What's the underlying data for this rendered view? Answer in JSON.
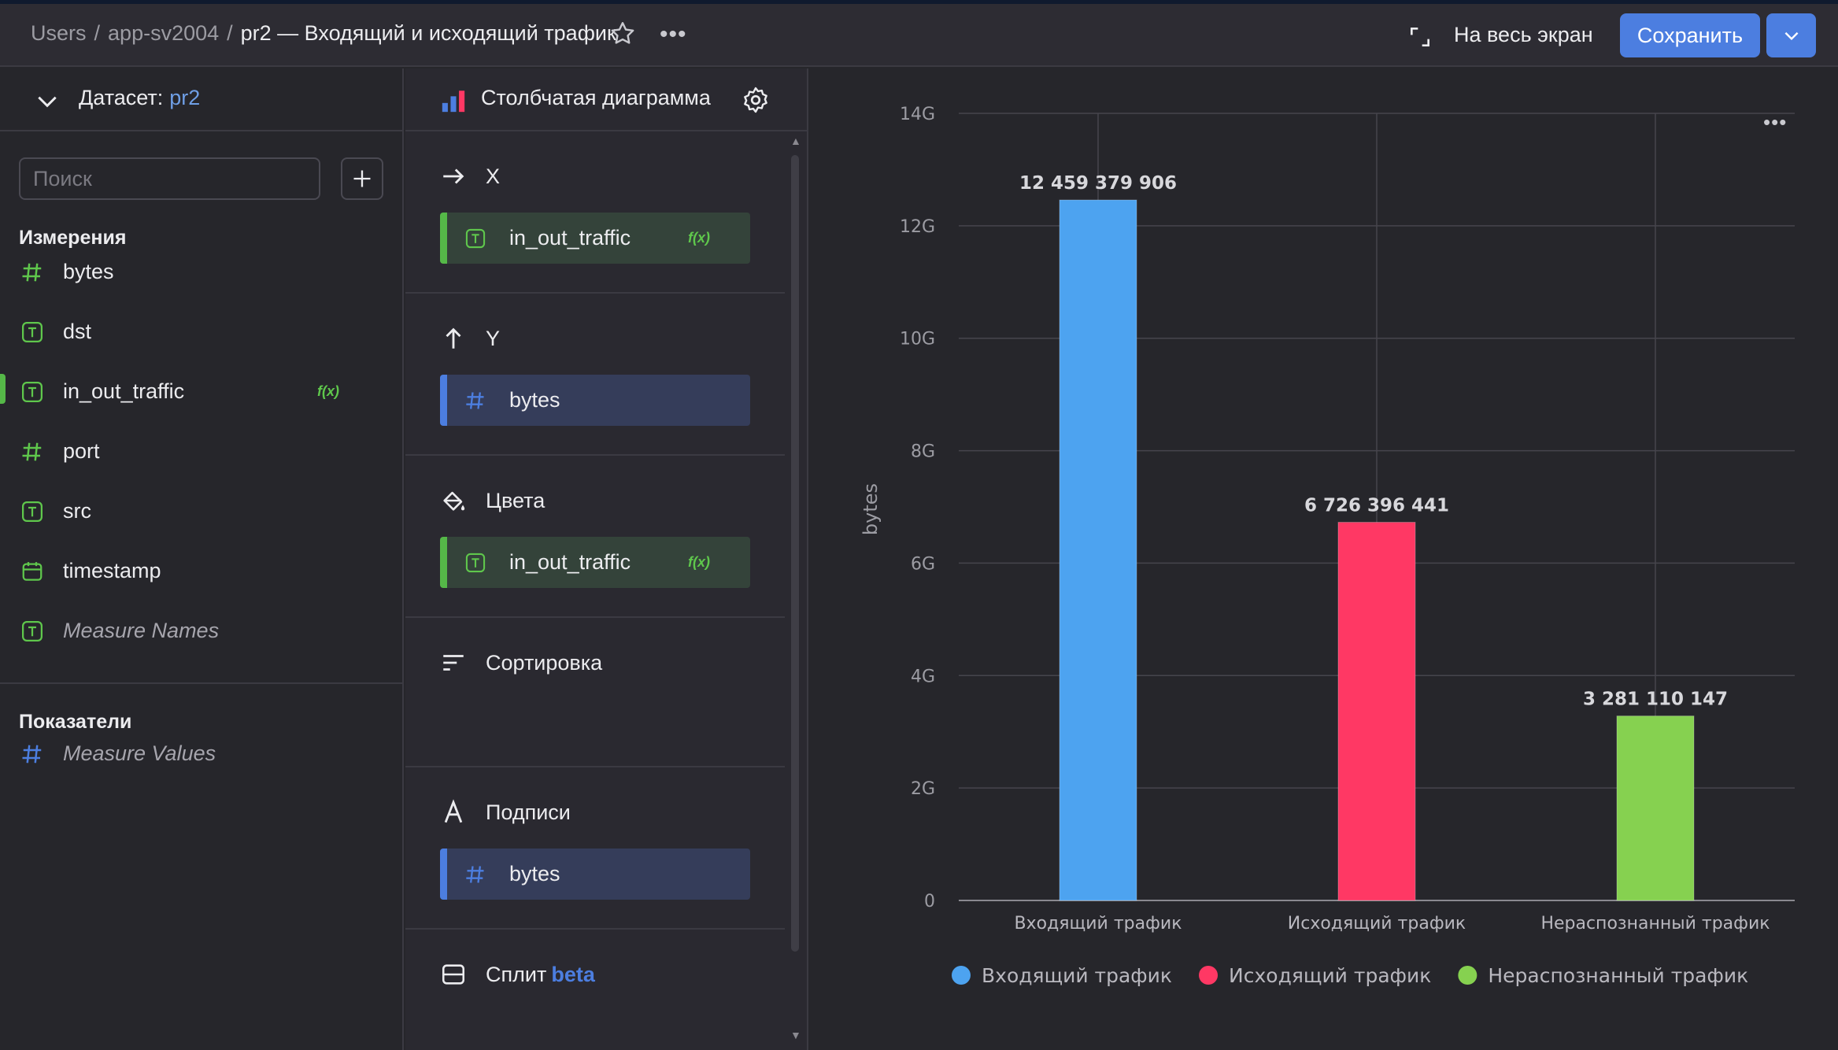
{
  "header": {
    "breadcrumbs": [
      "Users",
      "app-sv2004"
    ],
    "current": "pr2 — Входящий и исходящий трафик",
    "fullscreen_label": "На весь экран",
    "save_label": "Сохранить"
  },
  "dataset": {
    "label": "Датасет:",
    "name": "pr2",
    "search_placeholder": "Поиск"
  },
  "dimensions": {
    "title": "Измерения",
    "items": [
      {
        "label": "bytes",
        "type": "number"
      },
      {
        "label": "dst",
        "type": "text"
      },
      {
        "label": "in_out_traffic",
        "type": "text",
        "fx": "f(x)"
      },
      {
        "label": "port",
        "type": "number"
      },
      {
        "label": "src",
        "type": "text"
      },
      {
        "label": "timestamp",
        "type": "date"
      },
      {
        "label": "Measure Names",
        "type": "text"
      }
    ]
  },
  "measures": {
    "title": "Показатели",
    "items": [
      {
        "label": "Measure Values",
        "type": "number"
      }
    ]
  },
  "visualization": {
    "type_label": "Столбчатая диаграмма",
    "sections": {
      "x": {
        "title": "X",
        "chip": "in_out_traffic",
        "fx": "f(x)"
      },
      "y": {
        "title": "Y",
        "chip": "bytes"
      },
      "colors": {
        "title": "Цвета",
        "chip": "in_out_traffic",
        "fx": "f(x)"
      },
      "sort": {
        "title": "Сортировка"
      },
      "labels": {
        "title": "Подписи",
        "chip": "bytes"
      },
      "split": {
        "title": "Сплит",
        "badge": "beta"
      }
    }
  },
  "chart_data": {
    "type": "bar",
    "categories": [
      "Входящий трафик",
      "Исходящий трафик",
      "Нераспознанный трафик"
    ],
    "values": [
      12459379906,
      6726396441,
      3281110147
    ],
    "data_labels": [
      "12 459 379 906",
      "6 726 396 441",
      "3 281 110 147"
    ],
    "colors": [
      "#4da3f0",
      "#ff3864",
      "#86d150"
    ],
    "ylabel": "bytes",
    "ylim": [
      0,
      14000000000
    ],
    "yticks": [
      "0",
      "2G",
      "4G",
      "6G",
      "8G",
      "10G",
      "12G",
      "14G"
    ],
    "legend": [
      "Входящий трафик",
      "Исходящий трафик",
      "Нераспознанный трафик"
    ],
    "legend_position": "bottom",
    "grid": true
  }
}
